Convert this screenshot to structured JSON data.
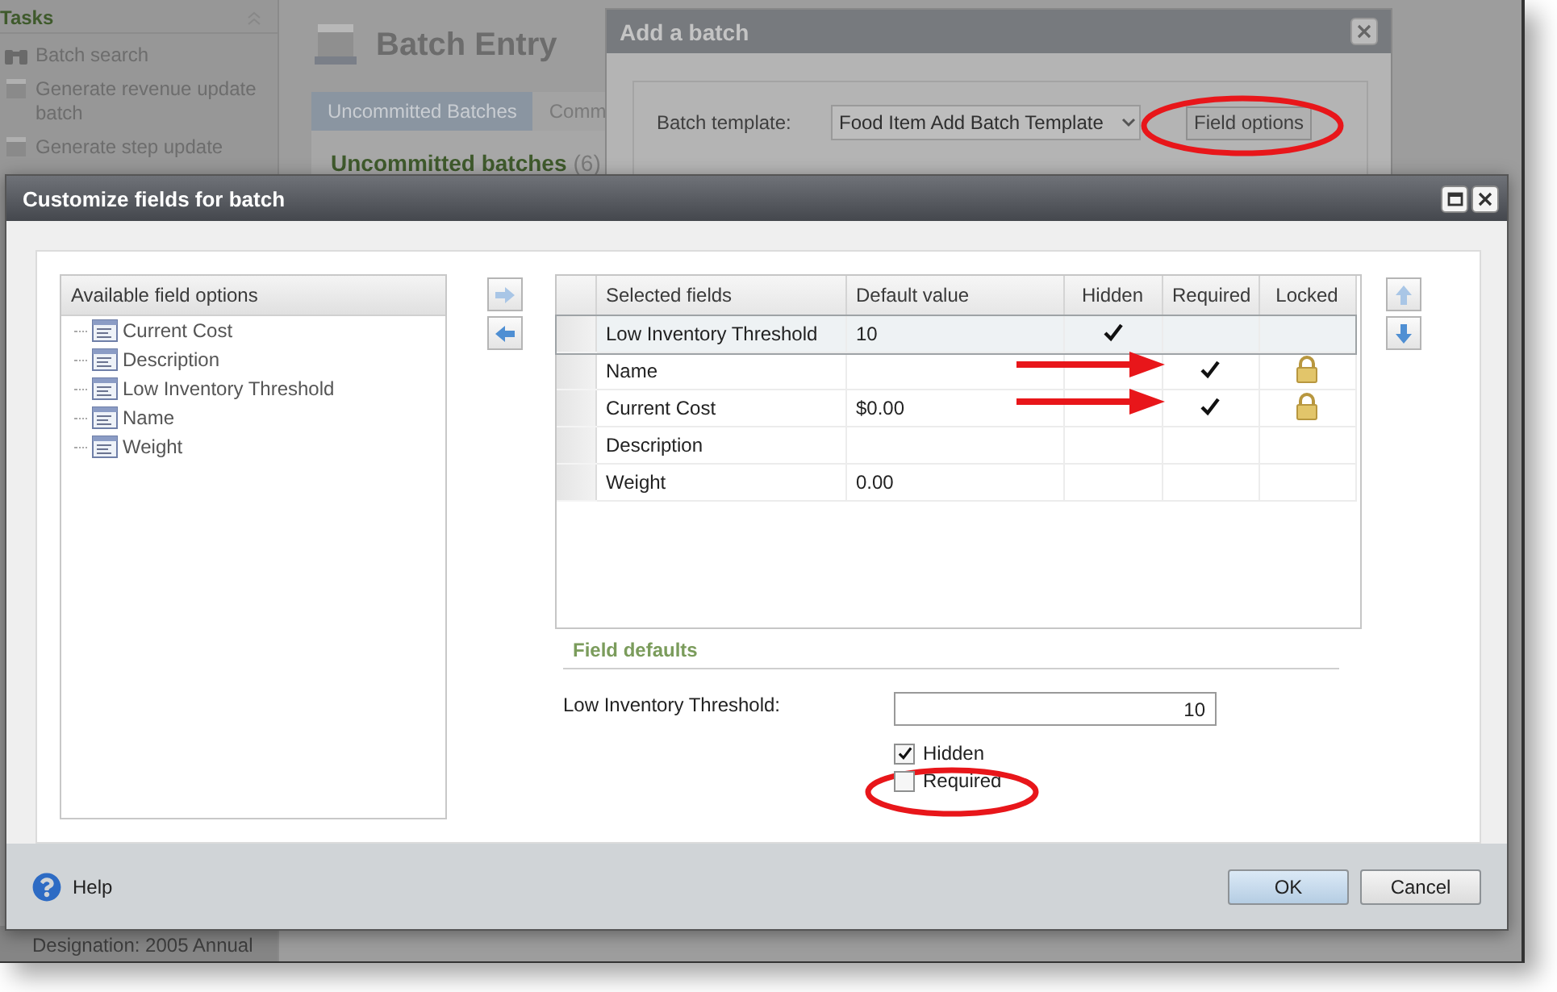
{
  "background": {
    "tasks_heading": "Tasks",
    "tasks": [
      "Batch search",
      "Generate revenue update batch",
      "Generate step update"
    ],
    "page_title": "Batch Entry",
    "tabs": [
      {
        "label": "Uncommitted Batches",
        "selected": true
      },
      {
        "label": "Comm",
        "selected": false
      }
    ],
    "section_title": "Uncommitted batches",
    "section_count": "(6)",
    "status_text": "Designation: 2005 Annual"
  },
  "add_batch_dialog": {
    "title": "Add a batch",
    "template_label": "Batch template:",
    "template_value": "Food Item Add Batch Template",
    "field_options_button": "Field options"
  },
  "customize_dialog": {
    "title": "Customize fields for batch",
    "available": {
      "heading": "Available field options",
      "items": [
        "Current Cost",
        "Description",
        "Low Inventory Threshold",
        "Name",
        "Weight"
      ]
    },
    "grid": {
      "columns": [
        "Selected fields",
        "Default value",
        "Hidden",
        "Required",
        "Locked"
      ],
      "rows": [
        {
          "field": "Low Inventory Threshold",
          "default_value": "10",
          "hidden": true,
          "required": false,
          "locked": false,
          "selected": true
        },
        {
          "field": "Name",
          "default_value": "",
          "hidden": false,
          "required": true,
          "locked": true,
          "selected": false
        },
        {
          "field": "Current Cost",
          "default_value": "$0.00",
          "hidden": false,
          "required": true,
          "locked": true,
          "selected": false
        },
        {
          "field": "Description",
          "default_value": "",
          "hidden": false,
          "required": false,
          "locked": false,
          "selected": false
        },
        {
          "field": "Weight",
          "default_value": "0.00",
          "hidden": false,
          "required": false,
          "locked": false,
          "selected": false
        }
      ]
    },
    "field_defaults": {
      "heading": "Field defaults",
      "label": "Low Inventory Threshold:",
      "value": "10",
      "options": [
        {
          "label": "Hidden",
          "checked": true
        },
        {
          "label": "Required",
          "checked": false
        }
      ]
    },
    "help": "Help",
    "buttons": [
      {
        "label": "OK",
        "default": true
      },
      {
        "label": "Cancel",
        "default": false
      }
    ]
  }
}
